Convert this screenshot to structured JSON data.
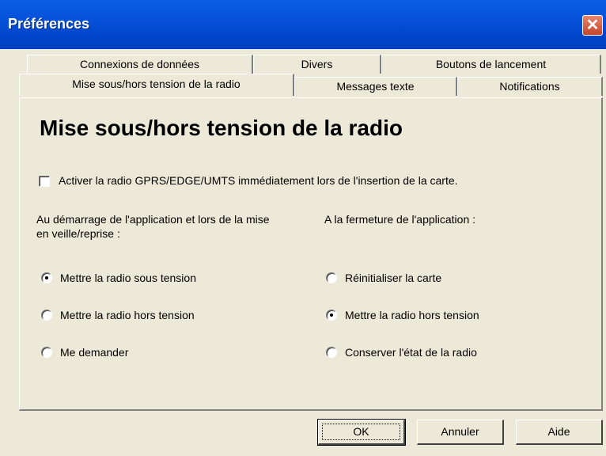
{
  "window": {
    "title": "Préférences",
    "close_label": "✕"
  },
  "tabs_row1": [
    "Connexions de données",
    "Divers",
    "Boutons de lancement"
  ],
  "tabs_row2": [
    "Mise sous/hors tension de la radio",
    "Messages texte",
    "Notifications"
  ],
  "active_tab": "Mise sous/hors tension de la radio",
  "panel": {
    "heading": "Mise sous/hors tension de la radio",
    "checkbox": {
      "label": "Activer la radio GPRS/EDGE/UMTS immédiatement lors de l'insertion de la carte.",
      "checked": false
    },
    "left_group": {
      "label_line1": "Au démarrage de l'application et lors de la mise",
      "label_line2": "en veille/reprise :",
      "options": [
        "Mettre la radio sous tension",
        "Mettre la radio hors tension",
        "Me demander"
      ],
      "selected": 0
    },
    "right_group": {
      "label": "A la fermeture de l'application :",
      "options": [
        "Réinitialiser la carte",
        "Mettre la radio hors tension",
        "Conserver l'état de la radio"
      ],
      "selected": 1
    }
  },
  "buttons": {
    "ok": "OK",
    "cancel": "Annuler",
    "help": "Aide"
  }
}
